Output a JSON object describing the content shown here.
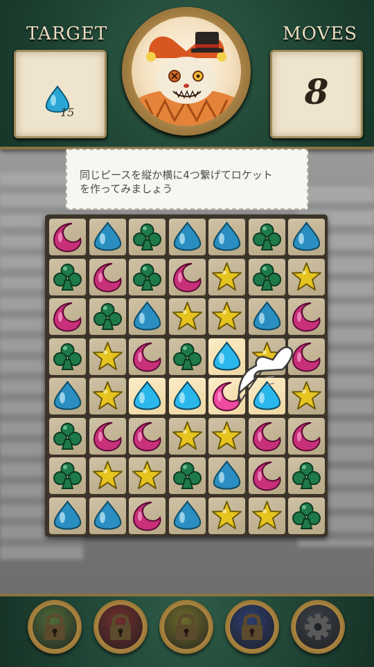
{
  "header": {
    "target_title": "TARGET",
    "target_gem": "blue-drop",
    "target_count": "15",
    "moves_title": "MOVES",
    "moves_count": "8",
    "portrait": "jester-cat-boss"
  },
  "tooltip": {
    "text_line1": "同じピースを縦か横に4つ繋げてロケット",
    "text_line2": "を作ってみましょう"
  },
  "board": {
    "rows": [
      [
        "moon",
        "drop",
        "club",
        "drop",
        "drop",
        "club",
        "drop"
      ],
      [
        "club",
        "moon",
        "club",
        "moon",
        "star",
        "club",
        "star"
      ],
      [
        "moon",
        "club",
        "drop",
        "star",
        "star",
        "drop",
        "moon"
      ],
      [
        "club",
        "star",
        "moon",
        "club",
        "drop",
        "star",
        "moon"
      ],
      [
        "drop",
        "star",
        "drop",
        "drop",
        "moon",
        "drop",
        "star"
      ],
      [
        "club",
        "moon",
        "moon",
        "star",
        "star",
        "moon",
        "moon"
      ],
      [
        "club",
        "star",
        "star",
        "club",
        "drop",
        "moon",
        "club"
      ],
      [
        "drop",
        "drop",
        "moon",
        "drop",
        "star",
        "star",
        "club"
      ]
    ],
    "highlighted": [
      [
        3,
        4
      ],
      [
        4,
        2
      ],
      [
        4,
        3
      ],
      [
        4,
        4
      ],
      [
        4,
        5
      ]
    ],
    "hint_hand": "pointing-hand"
  },
  "footer": {
    "buttons": [
      {
        "name": "locked-slot-1",
        "icon": "lock-icon",
        "color": "#4f6a3a"
      },
      {
        "name": "locked-slot-2",
        "icon": "lock-icon",
        "color": "#6e2f2f"
      },
      {
        "name": "locked-slot-3",
        "icon": "lock-icon",
        "color": "#6d6a2c"
      },
      {
        "name": "locked-slot-4",
        "icon": "lock-icon",
        "color": "#2d3d6e"
      },
      {
        "name": "settings",
        "icon": "gear-icon",
        "color": "#3a3f48"
      }
    ]
  },
  "colors": {
    "moon": "#c8307a",
    "drop": "#2a8fc0",
    "drop_bright": "#2ab8ec",
    "club": "#1f7a4a",
    "star": "#e6c420",
    "pink_bright": "#f04aa0"
  }
}
